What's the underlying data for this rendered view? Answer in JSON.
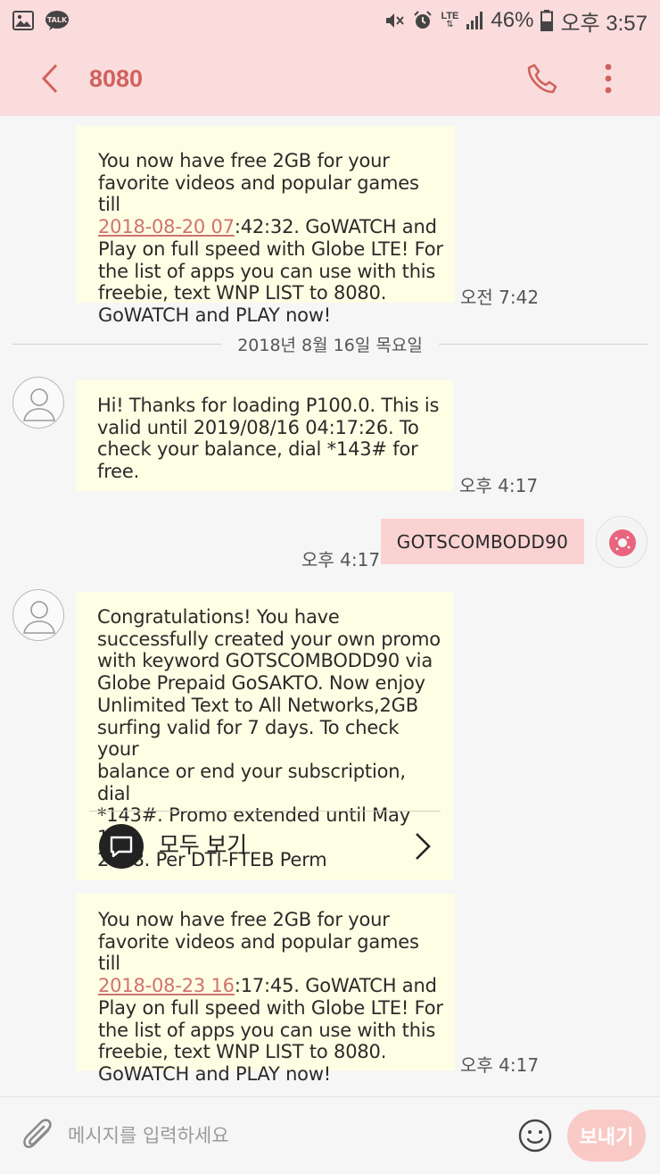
{
  "status_bar": {
    "network": "LTE",
    "battery": "46%",
    "time": "오후 3:57"
  },
  "header": {
    "title": "8080"
  },
  "date_separator": "2018년 8월 16일 목요일",
  "messages": [
    {
      "direction": "incoming",
      "text_before": "You now have free 2GB for your\nfavorite videos and popular games till\n",
      "link": "2018-08-20 07",
      "text_after": ":42:32. GoWATCH and\nPlay on full speed with Globe LTE! For\nthe list of apps you can use with this\nfreebie, text WNP LIST to 8080.\nGoWATCH and PLAY now!",
      "time": "오전 7:42"
    },
    {
      "direction": "incoming",
      "text": "Hi! Thanks for loading P100.0. This is\nvalid until 2019/08/16 04:17:26. To\ncheck your balance, dial *143# for\nfree.",
      "time": "오후 4:17"
    },
    {
      "direction": "outgoing",
      "text": "GOTSCOMBODD90",
      "time": "오후 4:17"
    },
    {
      "direction": "incoming",
      "text": "Congratulations! You have\nsuccessfully created your own  promo\nwith keyword GOTSCOMBODD90 via\nGlobe Prepaid GoSAKTO. Now enjoy\nUnlimited Text to All Networks,2GB\nsurfing valid for 7 days. To check your\nbalance or end your subscription, dial\n*143#. Promo extended until May 15,\n2018. Per DTI-FTEB Perm",
      "view_all_label": "모두 보기"
    },
    {
      "direction": "incoming",
      "text_before": "You now have free 2GB for your\nfavorite videos and popular games till\n",
      "link": "2018-08-23 16",
      "text_after": ":17:45. GoWATCH and\nPlay on full speed with Globe LTE! For\nthe list of apps you can use with this\nfreebie, text WNP LIST to 8080.\nGoWATCH and PLAY now!",
      "time": "오후 4:17"
    }
  ],
  "input": {
    "placeholder": "메시지를 입력하세요",
    "send_label": "보내기"
  },
  "colors": {
    "header_bg": "#fbdcdc",
    "accent": "#d0625e",
    "incoming_bubble": "#fefee4",
    "outgoing_bubble": "#fbd2d2",
    "send_button": "#f9c9c6"
  }
}
